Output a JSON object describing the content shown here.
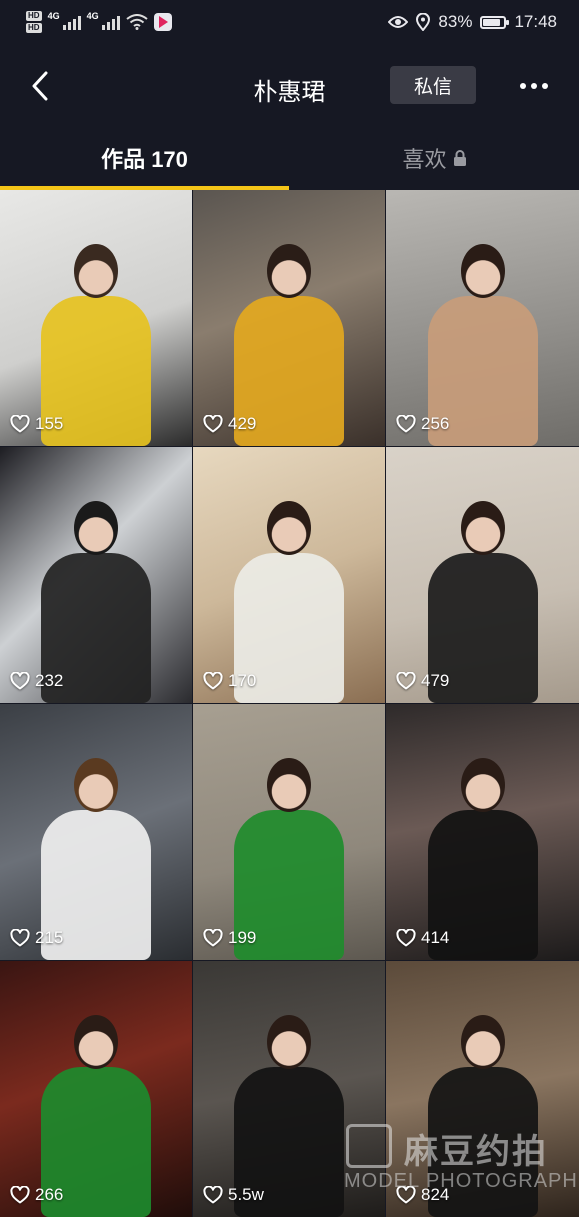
{
  "status_bar": {
    "network_left": "HD",
    "network_left2": "HD",
    "signal1": "4G",
    "signal2": "4G",
    "battery": "83%",
    "battery_level": 0.83,
    "time": "17:48"
  },
  "header": {
    "title": "朴惠珺",
    "message_button": "私信"
  },
  "tabs": [
    {
      "label": "作品 170",
      "active": true
    },
    {
      "label": "喜欢",
      "active": false,
      "locked": true
    }
  ],
  "videos": [
    {
      "likes": "155"
    },
    {
      "likes": "429"
    },
    {
      "likes": "256"
    },
    {
      "likes": "232"
    },
    {
      "likes": "170"
    },
    {
      "likes": "479"
    },
    {
      "likes": "215"
    },
    {
      "likes": "199"
    },
    {
      "likes": "414"
    },
    {
      "likes": "266"
    },
    {
      "likes": "5.5w"
    },
    {
      "likes": "824"
    }
  ],
  "watermark": {
    "text": "麻豆约拍",
    "sub": "MODEL PHOTOGRAPH"
  },
  "colors": {
    "background": "#161823",
    "accent": "#f5c518"
  }
}
